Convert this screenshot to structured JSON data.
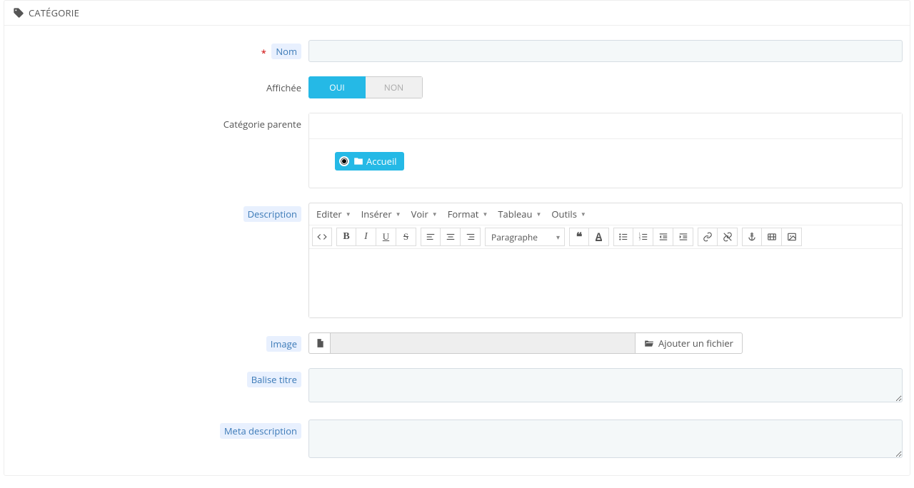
{
  "panel": {
    "title": "CATÉGORIE"
  },
  "labels": {
    "name": "Nom",
    "displayed": "Affichée",
    "parent_category": "Catégorie parente",
    "description": "Description",
    "image": "Image",
    "title_tag": "Balise titre",
    "meta_description": "Meta description"
  },
  "fields": {
    "name_value": "",
    "title_tag_value": "",
    "meta_description_value": "",
    "file_path": ""
  },
  "toggle": {
    "yes": "OUI",
    "no": "NON"
  },
  "tree": {
    "root_label": "Accueil",
    "search_placeholder": ""
  },
  "editor": {
    "menu": {
      "edit": "Editer",
      "insert": "Insérer",
      "view": "Voir",
      "format": "Format",
      "table": "Tableau",
      "tools": "Outils"
    },
    "block_label": "Paragraphe"
  },
  "image": {
    "add_file": "Ajouter un fichier"
  }
}
